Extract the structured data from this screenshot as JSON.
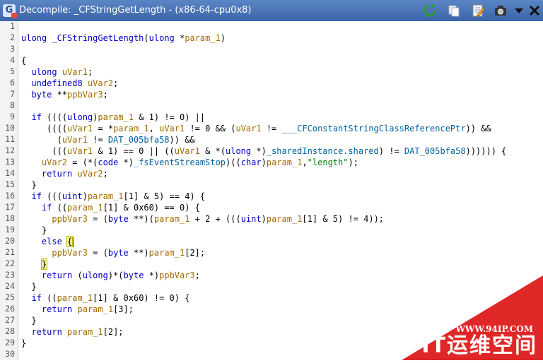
{
  "window": {
    "title": "Decompile: _CFStringGetLength -  (x86-64-cpu0x8)",
    "toolbar": [
      "refresh-icon",
      "copy-icon",
      "edit-icon",
      "snapshot-icon",
      "menu-icon",
      "close-icon"
    ]
  },
  "code": {
    "line_numbers": [
      "1",
      "2",
      "3",
      "4",
      "5",
      "6",
      "7",
      "8",
      "9",
      "10",
      "11",
      "12",
      "13",
      "14",
      "15",
      "16",
      "17",
      "18",
      "19",
      "20",
      "21",
      "22",
      "23",
      "24",
      "25",
      "26",
      "27",
      "28",
      "29",
      "30"
    ],
    "lines": [
      "",
      "ulong _CFStringGetLength(ulong *param_1)",
      "",
      "{",
      "  ulong uVar1;",
      "  undefined8 uVar2;",
      "  byte **ppbVar3;",
      "",
      "  if ((((ulong)param_1 & 1) != 0) ||",
      "     ((((uVar1 = *param_1, uVar1 != 0 && (uVar1 != ___CFConstantStringClassReferencePtr)) &&",
      "       (uVar1 != DAT_005bfa58)) &&",
      "      (((uVar1 & 1) == 0 || ((uVar1 & *(ulong *)_sharedInstance.shared) != DAT_005bfa58)))))) {",
      "    uVar2 = (*(code *)_fsEventStreamStop)((char)param_1,\"length\");",
      "    return uVar2;",
      "  }",
      "  if (((uint)param_1[1] & 5) == 4) {",
      "    if ((param_1[1] & 0x60) == 0) {",
      "      ppbVar3 = (byte **)(param_1 + 2 + (((uint)param_1[1] & 5) != 4));",
      "    }",
      "    else {",
      "      ppbVar3 = (byte **)param_1[2];",
      "    }",
      "    return (ulong)*(byte *)ppbVar3;",
      "  }",
      "  if ((param_1[1] & 0x60) != 0) {",
      "    return param_1[3];",
      "  }",
      "  return param_1[2];",
      "}",
      ""
    ]
  },
  "watermark": {
    "url": "WWW.94IP.COM",
    "text": "IT运维空间"
  },
  "colors": {
    "keyword": "#0000c0",
    "variable": "#a36a00",
    "string": "#008000",
    "titlebar": "#4a75b8",
    "watermark": "#e02727"
  }
}
